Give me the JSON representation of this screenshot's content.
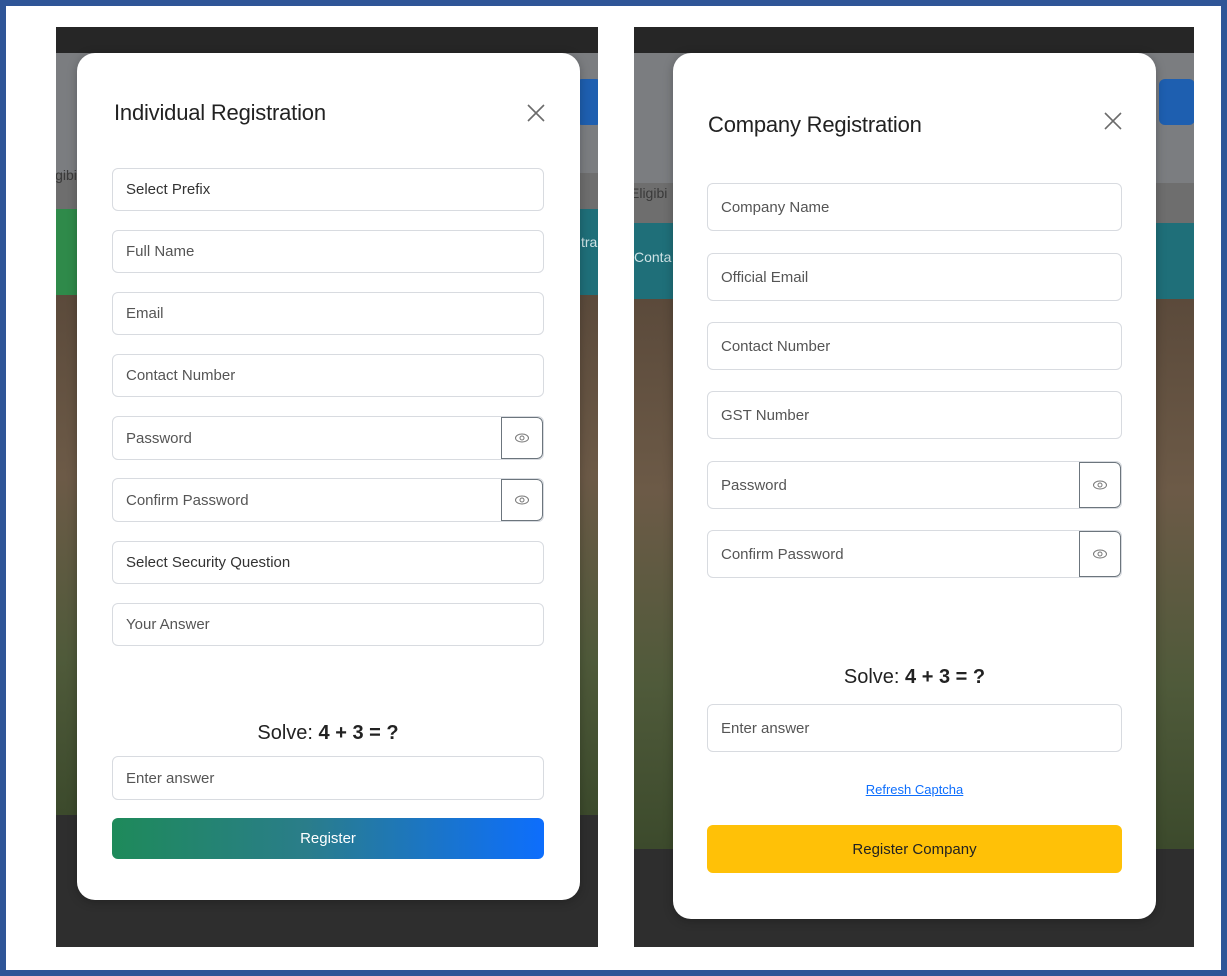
{
  "background": {
    "left_peek_eligibility": "igibi",
    "left_peek_nav": "tra",
    "right_peek_eligibility": "Eligibi",
    "right_peek_contact": "Conta"
  },
  "individual": {
    "title": "Individual Registration",
    "prefix_select": "Select Prefix",
    "full_name_placeholder": "Full Name",
    "email_placeholder": "Email",
    "contact_placeholder": "Contact Number",
    "password_placeholder": "Password",
    "confirm_password_placeholder": "Confirm Password",
    "security_question_select": "Select Security Question",
    "answer_placeholder": "Your Answer",
    "captcha_prefix": "Solve: ",
    "captcha_expr": "4 + 3 = ?",
    "captcha_answer_placeholder": "Enter answer",
    "register_label": "Register"
  },
  "company": {
    "title": "Company Registration",
    "company_name_placeholder": "Company Name",
    "official_email_placeholder": "Official Email",
    "contact_placeholder": "Contact Number",
    "gst_placeholder": "GST Number",
    "password_placeholder": "Password",
    "confirm_password_placeholder": "Confirm Password",
    "captcha_prefix": "Solve: ",
    "captcha_expr": "4 + 3 = ?",
    "captcha_answer_placeholder": "Enter answer",
    "refresh_label": "Refresh Captcha",
    "register_label": "Register Company"
  },
  "colors": {
    "frame_border": "#2f5597",
    "register_gradient_start": "#1e8a5a",
    "register_gradient_end": "#0d6efd",
    "company_button": "#ffc107",
    "link": "#0d6efd"
  }
}
